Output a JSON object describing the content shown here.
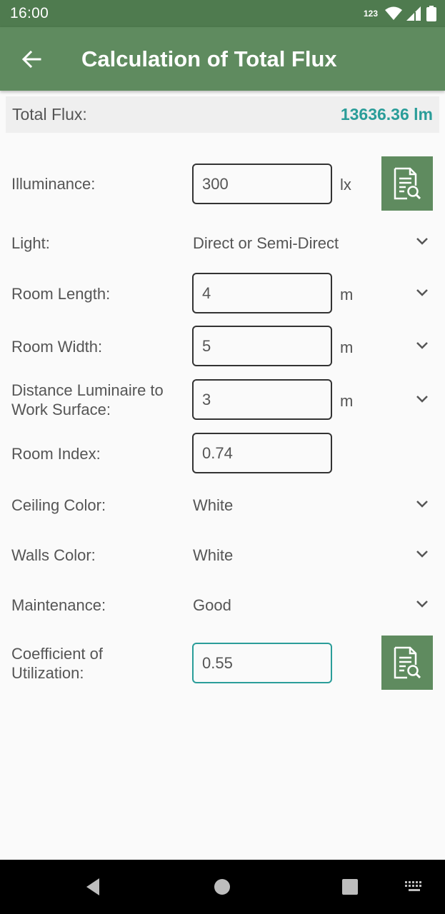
{
  "status_bar": {
    "time": "16:00",
    "network": "123"
  },
  "app_bar": {
    "title": "Calculation of Total Flux"
  },
  "total": {
    "label": "Total Flux:",
    "value": "13636.36 lm"
  },
  "form": {
    "illuminance": {
      "label": "Illuminance:",
      "value": "300",
      "unit": "lx"
    },
    "light": {
      "label": "Light:",
      "value": "Direct or Semi-Direct"
    },
    "room_length": {
      "label": "Room Length:",
      "value": "4",
      "unit": "m"
    },
    "room_width": {
      "label": "Room Width:",
      "value": "5",
      "unit": "m"
    },
    "distance": {
      "label_line1": "Distance Luminaire to",
      "label_line2": "Work Surface:",
      "value": "3",
      "unit": "m"
    },
    "room_index": {
      "label": "Room Index:",
      "value": "0.74"
    },
    "ceiling_color": {
      "label": "Ceiling Color:",
      "value": "White"
    },
    "walls_color": {
      "label": "Walls Color:",
      "value": "White"
    },
    "maintenance": {
      "label": "Maintenance:",
      "value": "Good"
    },
    "coefficient": {
      "label_line1": "Coefficient of",
      "label_line2": "Utilization:",
      "value": "0.55"
    }
  },
  "colors": {
    "status_bar": "#4f7b4f",
    "app_bar": "#5f8b5f",
    "accent": "#2a9d99",
    "doc_button": "#5f8b5f"
  },
  "icons": [
    "back-arrow-icon",
    "wifi-icon",
    "signal-icon",
    "battery-icon",
    "document-search-icon",
    "chevron-down-icon",
    "nav-back-icon",
    "nav-home-icon",
    "nav-recents-icon",
    "keyboard-icon"
  ]
}
